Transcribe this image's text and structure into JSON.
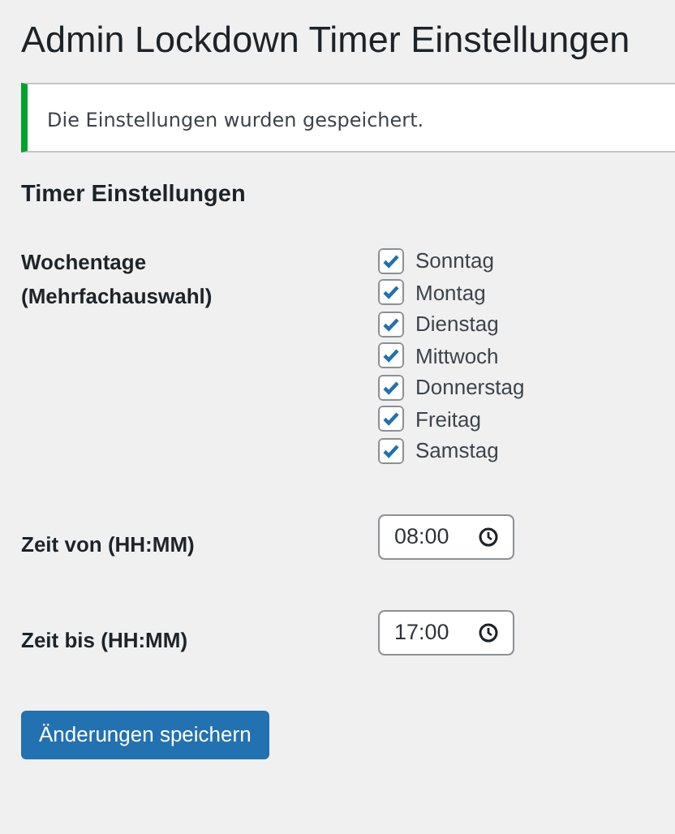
{
  "title": "Admin Lockdown Timer Einstellungen",
  "notice": {
    "kind": "success",
    "text": "Die Einstellungen wurden gespeichert."
  },
  "section_title": "Timer Einstellungen",
  "weekdays": {
    "label": "Wochentage (Mehrfachauswahl)",
    "options": [
      {
        "label": "Sonntag",
        "checked": true
      },
      {
        "label": "Montag",
        "checked": true
      },
      {
        "label": "Dienstag",
        "checked": true
      },
      {
        "label": "Mittwoch",
        "checked": true
      },
      {
        "label": "Donnerstag",
        "checked": true
      },
      {
        "label": "Freitag",
        "checked": true
      },
      {
        "label": "Samstag",
        "checked": true
      }
    ]
  },
  "time_fields": [
    {
      "label": "Zeit von (HH:MM)",
      "value": "08:00"
    },
    {
      "label": "Zeit bis (HH:MM)",
      "value": "17:00"
    }
  ],
  "submit_button": "Änderungen speichern"
}
